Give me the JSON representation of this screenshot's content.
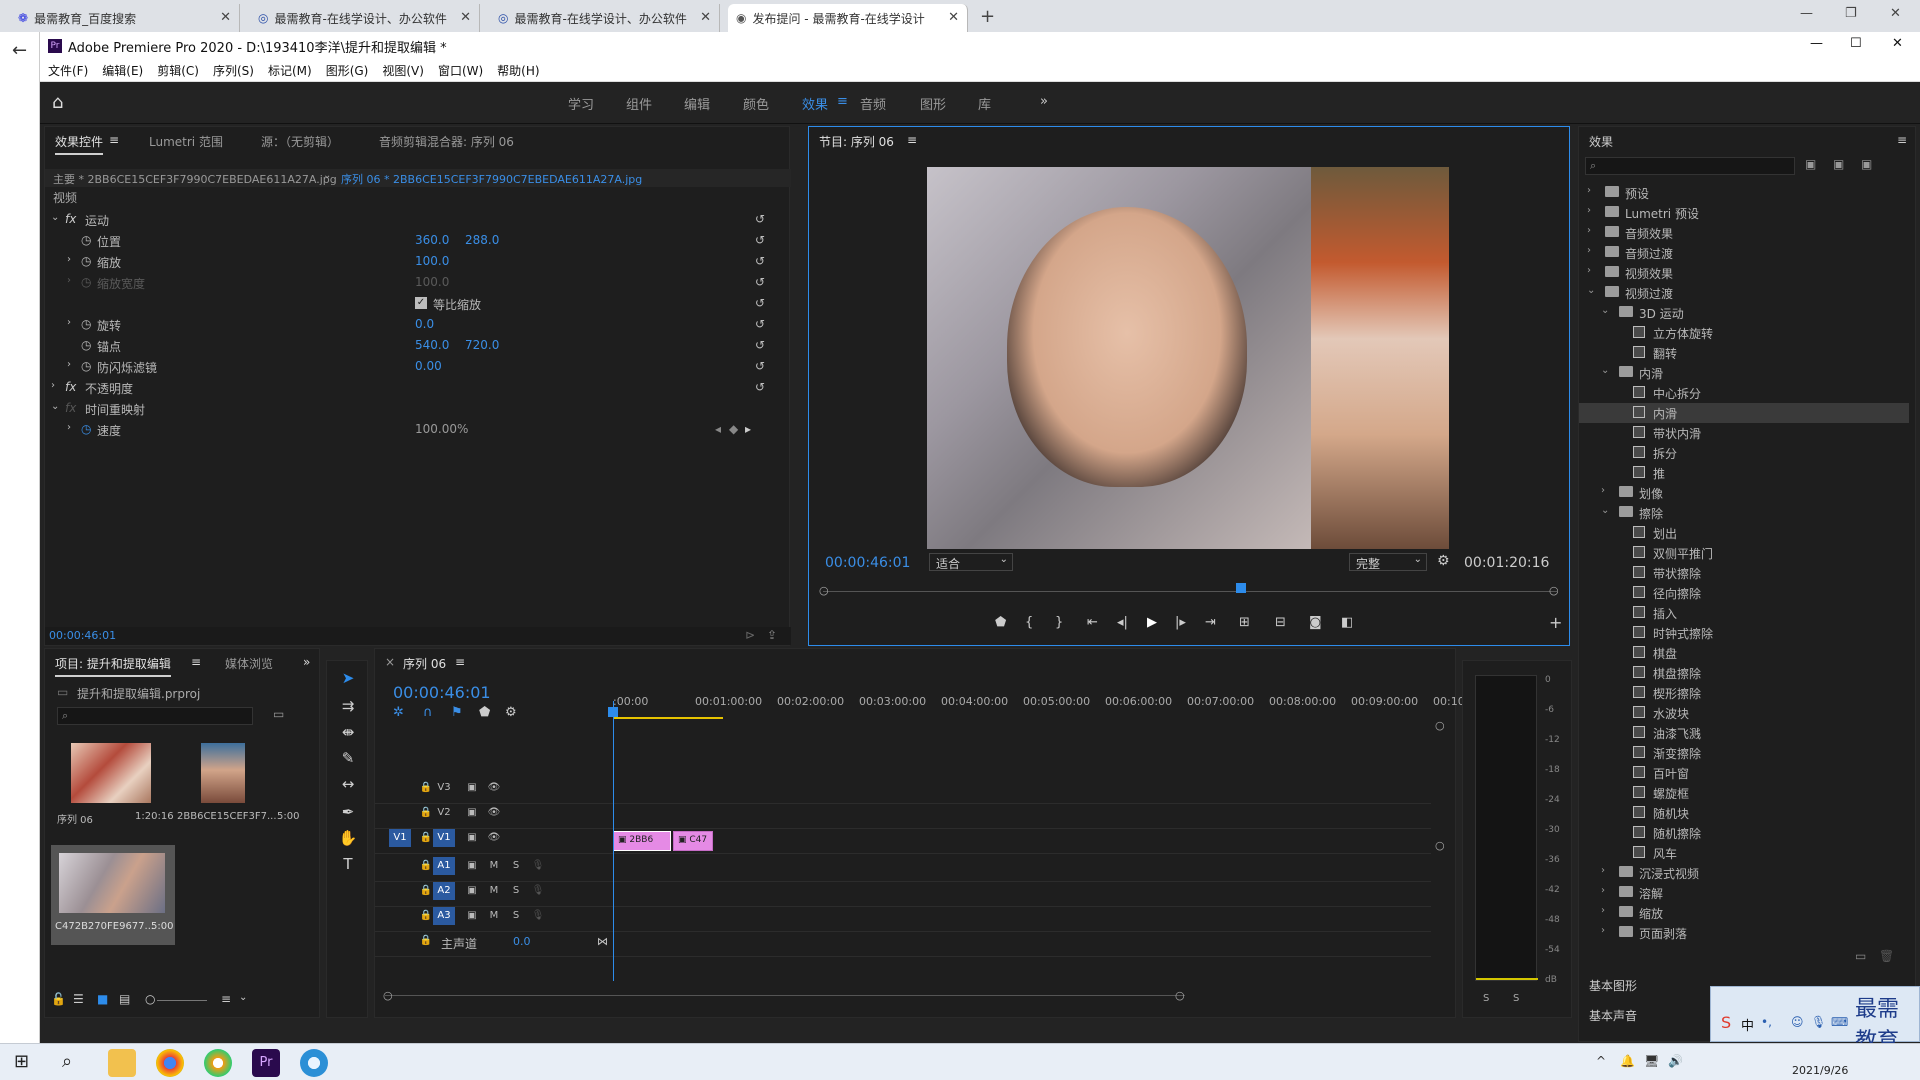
{
  "browser": {
    "tabs": [
      {
        "title": "最需教育_百度搜索"
      },
      {
        "title": "最需教育-在线学设计、办公软件"
      },
      {
        "title": "最需教育-在线学设计、办公软件"
      },
      {
        "title": "发布提问 - 最需教育-在线学设计"
      }
    ],
    "new_tab": "+"
  },
  "app": {
    "title": "Adobe Premiere Pro 2020 - D:\\193410李洋\\提升和提取编辑 *",
    "menu": [
      "文件(F)",
      "编辑(E)",
      "剪辑(C)",
      "序列(S)",
      "标记(M)",
      "图形(G)",
      "视图(V)",
      "窗口(W)",
      "帮助(H)"
    ],
    "workspaces": [
      "学习",
      "组件",
      "编辑",
      "颜色",
      "效果",
      "音频",
      "图形",
      "库"
    ],
    "active_workspace": "效果"
  },
  "effect_controls": {
    "tabs": [
      "效果控件",
      "Lumetri 范围",
      "源：（无剪辑）",
      "音频剪辑混合器: 序列 06"
    ],
    "master_label": "主要 * 2BB6CE15CEF3F7990C7EBEDAE611A27A.jpg",
    "sequence_label": "序列 06 * 2BB6CE15CEF3F7990C7EBEDAE611A27A.jpg",
    "section_video": "视频",
    "motion": "运动",
    "rows": [
      {
        "label": "位置",
        "v1": "360.0",
        "v2": "288.0"
      },
      {
        "label": "缩放",
        "v1": "100.0",
        "v2": ""
      },
      {
        "label": "缩放宽度",
        "v1": "100.0",
        "v2": ""
      },
      {
        "label": "等比缩放",
        "v1": "",
        "v2": ""
      },
      {
        "label": "旋转",
        "v1": "0.0",
        "v2": ""
      },
      {
        "label": "锚点",
        "v1": "540.0",
        "v2": "720.0"
      },
      {
        "label": "防闪烁滤镜",
        "v1": "0.00",
        "v2": ""
      }
    ],
    "opacity": "不透明度",
    "time_remap": "时间重映射",
    "speed_label": "速度",
    "speed_value": "100.00%",
    "timecode": "00:00:46:01"
  },
  "program": {
    "title": "节目: 序列 06",
    "timecode": "00:00:46:01",
    "fit": "适合",
    "quality": "完整",
    "duration": "00:01:20:16",
    "playhead_fraction": 0.57
  },
  "project": {
    "tabs": [
      "项目: 提升和提取编辑",
      "媒体浏览"
    ],
    "filename": "提升和提取编辑.prproj",
    "items": [
      {
        "name": "序列 06",
        "duration": "1:20:16"
      },
      {
        "name": "2BB6CE15CEF3F7...",
        "duration": "5:00"
      },
      {
        "name": "C472B270FE9677...",
        "duration": "5:00"
      }
    ]
  },
  "timeline": {
    "tab": "序列 06",
    "timecode": "00:00:46:01",
    "ruler": [
      ":00:00",
      "00:01:00:00",
      "00:02:00:00",
      "00:03:00:00",
      "00:04:00:00",
      "00:05:00:00",
      "00:06:00:00",
      "00:07:00:00",
      "00:08:00:00",
      "00:09:00:00",
      "00:10"
    ],
    "video_tracks": [
      "V3",
      "V2",
      "V1"
    ],
    "audio_tracks": [
      "A1",
      "A2",
      "A3"
    ],
    "master": "主声道",
    "master_value": "0.0",
    "clips": [
      {
        "label": "2BB6"
      },
      {
        "label": "C47"
      }
    ],
    "source_patch": "V1",
    "m_label": "M",
    "s_label": "S"
  },
  "meters": {
    "scale": [
      "0",
      "-6",
      "-12",
      "-18",
      "-24",
      "-30",
      "-36",
      "-42",
      "-48",
      "-54",
      "dB"
    ],
    "solo": [
      "S",
      "S"
    ]
  },
  "effects_panel": {
    "title": "效果",
    "tree": [
      {
        "label": "预设",
        "type": "folder",
        "depth": 0,
        "open": false
      },
      {
        "label": "Lumetri 预设",
        "type": "folder",
        "depth": 0,
        "open": false
      },
      {
        "label": "音频效果",
        "type": "folder",
        "depth": 0,
        "open": false
      },
      {
        "label": "音频过渡",
        "type": "folder",
        "depth": 0,
        "open": false
      },
      {
        "label": "视频效果",
        "type": "folder",
        "depth": 0,
        "open": false
      },
      {
        "label": "视频过渡",
        "type": "folder",
        "depth": 0,
        "open": true
      },
      {
        "label": "3D 运动",
        "type": "folder",
        "depth": 1,
        "open": true
      },
      {
        "label": "立方体旋转",
        "type": "effect",
        "depth": 2
      },
      {
        "label": "翻转",
        "type": "effect",
        "depth": 2
      },
      {
        "label": "内滑",
        "type": "folder",
        "depth": 1,
        "open": true
      },
      {
        "label": "中心拆分",
        "type": "effect",
        "depth": 2
      },
      {
        "label": "内滑",
        "type": "effect",
        "depth": 2,
        "selected": true
      },
      {
        "label": "带状内滑",
        "type": "effect",
        "depth": 2
      },
      {
        "label": "拆分",
        "type": "effect",
        "depth": 2
      },
      {
        "label": "推",
        "type": "effect",
        "depth": 2
      },
      {
        "label": "划像",
        "type": "folder",
        "depth": 1,
        "open": false
      },
      {
        "label": "擦除",
        "type": "folder",
        "depth": 1,
        "open": true
      },
      {
        "label": "划出",
        "type": "effect",
        "depth": 2
      },
      {
        "label": "双侧平推门",
        "type": "effect",
        "depth": 2
      },
      {
        "label": "带状擦除",
        "type": "effect",
        "depth": 2
      },
      {
        "label": "径向擦除",
        "type": "effect",
        "depth": 2
      },
      {
        "label": "插入",
        "type": "effect",
        "depth": 2
      },
      {
        "label": "时钟式擦除",
        "type": "effect",
        "depth": 2
      },
      {
        "label": "棋盘",
        "type": "effect",
        "depth": 2
      },
      {
        "label": "棋盘擦除",
        "type": "effect",
        "depth": 2
      },
      {
        "label": "楔形擦除",
        "type": "effect",
        "depth": 2
      },
      {
        "label": "水波块",
        "type": "effect",
        "depth": 2
      },
      {
        "label": "油漆飞溅",
        "type": "effect",
        "depth": 2
      },
      {
        "label": "渐变擦除",
        "type": "effect",
        "depth": 2
      },
      {
        "label": "百叶窗",
        "type": "effect",
        "depth": 2
      },
      {
        "label": "螺旋框",
        "type": "effect",
        "depth": 2
      },
      {
        "label": "随机块",
        "type": "effect",
        "depth": 2
      },
      {
        "label": "随机擦除",
        "type": "effect",
        "depth": 2
      },
      {
        "label": "风车",
        "type": "effect",
        "depth": 2
      },
      {
        "label": "沉浸式视频",
        "type": "folder",
        "depth": 1,
        "open": false
      },
      {
        "label": "溶解",
        "type": "folder",
        "depth": 1,
        "open": false
      },
      {
        "label": "缩放",
        "type": "folder",
        "depth": 1,
        "open": false
      },
      {
        "label": "页面剥落",
        "type": "folder",
        "depth": 1,
        "open": false
      }
    ],
    "bottom": [
      "基本图形",
      "基本声音"
    ]
  },
  "taskbar": {
    "date": "2021/9/26",
    "watermark": "最需教育",
    "ime": "中"
  },
  "colors": {
    "accent": "#2d8ceb",
    "clip": "#e58ae5",
    "panel_bg": "#1e1e1e"
  }
}
